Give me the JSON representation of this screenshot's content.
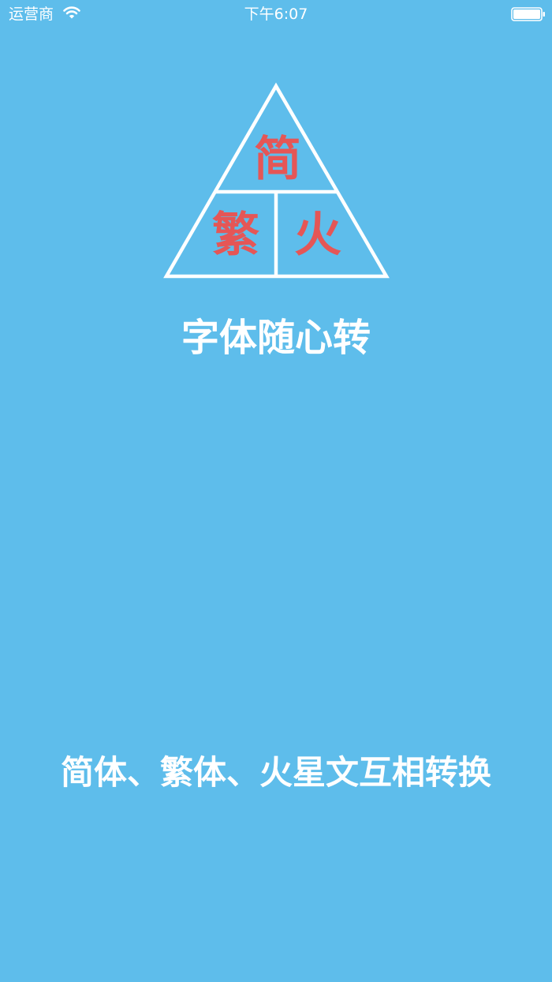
{
  "status_bar": {
    "carrier": "运营商",
    "time": "下午6:07",
    "wifi_icon": "wifi-icon",
    "battery_icon": "battery-icon"
  },
  "logo": {
    "top_char": "简",
    "left_char": "繁",
    "right_char": "火",
    "char_color": "#E55656",
    "line_color": "#FFFFFF"
  },
  "title": "字体随心转",
  "tagline": "简体、繁体、火星文互相转换",
  "colors": {
    "background": "#5EBDEB",
    "text": "#FFFFFF"
  }
}
